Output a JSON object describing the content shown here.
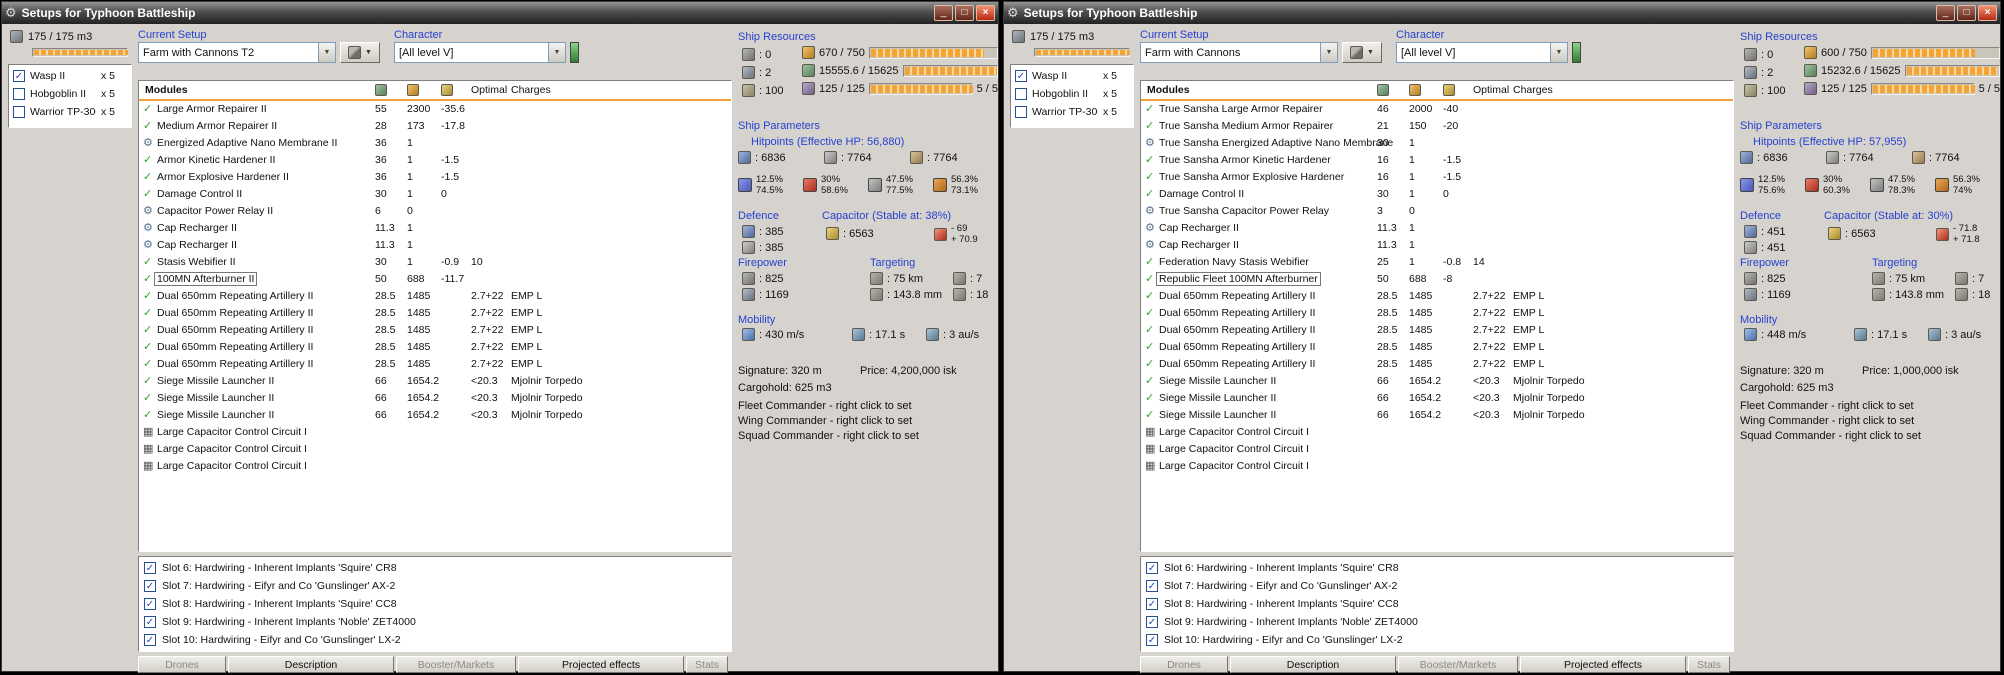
{
  "chrome": {
    "title": "Setups for Typhoon Battleship"
  },
  "labels": {
    "current_setup": "Current Setup",
    "character": "Character",
    "modules": "Modules",
    "optimal": "Optimal",
    "charges": "Charges",
    "ship_resources": "Ship Resources",
    "ship_parameters": "Ship Parameters",
    "defence": "Defence",
    "firepower": "Firepower",
    "targeting": "Targeting",
    "mobility": "Mobility"
  },
  "tabs": [
    {
      "label": "Drones",
      "enabled": false
    },
    {
      "label": "Description",
      "enabled": true
    },
    {
      "label": "Booster/Markets",
      "enabled": false
    },
    {
      "label": "Projected effects",
      "enabled": true
    },
    {
      "label": "Stats",
      "enabled": false
    }
  ],
  "windows": [
    {
      "cargo": {
        "value": "175 / 175 m3",
        "fill": 1
      },
      "drones": [
        {
          "name": "Wasp II",
          "qty": "x 5",
          "checked": true
        },
        {
          "name": "Hobgoblin II",
          "qty": "x 5",
          "checked": false
        },
        {
          "name": "Warrior TP-300",
          "qty": "x 5",
          "checked": false
        }
      ],
      "current_setup": "Farm with Cannons T2",
      "character": "[All level V]",
      "modules": [
        {
          "state": "active",
          "name": "Large Armor Repairer II",
          "cpu": "55",
          "pg": "2300",
          "cap": "-35.6"
        },
        {
          "state": "active",
          "name": "Medium Armor Repairer II",
          "cpu": "28",
          "pg": "173",
          "cap": "-17.8"
        },
        {
          "state": "passive",
          "name": "Energized Adaptive Nano Membrane II",
          "cpu": "36",
          "pg": "1"
        },
        {
          "state": "active",
          "name": "Armor Kinetic Hardener II",
          "cpu": "36",
          "pg": "1",
          "cap": "-1.5"
        },
        {
          "state": "active",
          "name": "Armor Explosive Hardener II",
          "cpu": "36",
          "pg": "1",
          "cap": "-1.5"
        },
        {
          "state": "active",
          "name": "Damage Control II",
          "cpu": "30",
          "pg": "1",
          "cap": "0"
        },
        {
          "state": "passive",
          "name": "Capacitor Power Relay II",
          "cpu": "6",
          "pg": "0"
        },
        {
          "state": "passive",
          "name": "Cap Recharger II",
          "cpu": "11.3",
          "pg": "1"
        },
        {
          "state": "passive",
          "name": "Cap Recharger II",
          "cpu": "11.3",
          "pg": "1"
        },
        {
          "state": "active",
          "name": "Stasis Webifier II",
          "cpu": "30",
          "pg": "1",
          "cap": "-0.9",
          "optimal": "10"
        },
        {
          "state": "active",
          "name": "100MN Afterburner II",
          "cpu": "50",
          "pg": "688",
          "cap": "-11.7",
          "selected": true
        },
        {
          "state": "active",
          "name": "Dual 650mm Repeating Artillery II",
          "cpu": "28.5",
          "pg": "1485",
          "optimal": "2.7+22",
          "charges": "EMP L"
        },
        {
          "state": "active",
          "name": "Dual 650mm Repeating Artillery II",
          "cpu": "28.5",
          "pg": "1485",
          "optimal": "2.7+22",
          "charges": "EMP L"
        },
        {
          "state": "active",
          "name": "Dual 650mm Repeating Artillery II",
          "cpu": "28.5",
          "pg": "1485",
          "optimal": "2.7+22",
          "charges": "EMP L"
        },
        {
          "state": "active",
          "name": "Dual 650mm Repeating Artillery II",
          "cpu": "28.5",
          "pg": "1485",
          "optimal": "2.7+22",
          "charges": "EMP L"
        },
        {
          "state": "active",
          "name": "Dual 650mm Repeating Artillery II",
          "cpu": "28.5",
          "pg": "1485",
          "optimal": "2.7+22",
          "charges": "EMP L"
        },
        {
          "state": "active",
          "name": "Siege Missile Launcher II",
          "cpu": "66",
          "pg": "1654.2",
          "optimal": "<20.3",
          "charges": "Mjolnir Torpedo"
        },
        {
          "state": "active",
          "name": "Siege Missile Launcher II",
          "cpu": "66",
          "pg": "1654.2",
          "optimal": "<20.3",
          "charges": "Mjolnir Torpedo"
        },
        {
          "state": "active",
          "name": "Siege Missile Launcher II",
          "cpu": "66",
          "pg": "1654.2",
          "optimal": "<20.3",
          "charges": "Mjolnir Torpedo"
        },
        {
          "state": "rig",
          "name": "Large Capacitor Control Circuit I"
        },
        {
          "state": "rig",
          "name": "Large Capacitor Control Circuit I"
        },
        {
          "state": "rig",
          "name": "Large Capacitor Control Circuit I"
        }
      ],
      "implants": [
        "Slot 6: Hardwiring - Inherent Implants 'Squire' CR8",
        "Slot 7: Hardwiring - Eifyr and Co 'Gunslinger' AX-2",
        "Slot 8: Hardwiring - Inherent Implants 'Squire' CC8",
        "Slot 9: Hardwiring - Inherent Implants 'Noble' ZET4000",
        "Slot 10: Hardwiring - Eifyr and Co 'Gunslinger' LX-2"
      ],
      "resources": {
        "turrets": ": 0",
        "launchers": ": 2",
        "calibration": ": 100",
        "powergrid": {
          "text": "670 / 750",
          "fill": 0.89
        },
        "cpu": {
          "text": "15555.6 / 15625",
          "fill": 0.99
        },
        "dronebay": {
          "text": "125 / 125",
          "fill": 1
        },
        "drones_count": "5 / 5"
      },
      "parameters": {
        "hitpoints_title": "Hitpoints (Effective HP: 56,880)",
        "shield": ": 6836",
        "armor": ": 7764",
        "hull": ": 7764",
        "resists": [
          {
            "top": "12.5%",
            "bottom": "74.5%"
          },
          {
            "top": "30%",
            "bottom": "58.6%"
          },
          {
            "top": "47.5%",
            "bottom": "77.5%"
          },
          {
            "top": "56.3%",
            "bottom": "73.1%"
          }
        ],
        "defence_shield": ": 385",
        "defence_armor": ": 385",
        "capacitor_title": "Capacitor (Stable at: 38%)",
        "cap_amount": ": 6563",
        "cap_out": "- 69",
        "cap_in": "+ 70.9",
        "firepower_dps": ": 825",
        "firepower_volley": ": 1169",
        "targeting_range": ": 75 km",
        "max_targets": ": 7",
        "scan_resolution": ": 143.8 mm",
        "sensor_strength": ": 18",
        "speed": ": 430 m/s",
        "align_time": ": 17.1 s",
        "warp_speed": ": 3 au/s",
        "signature": "Signature: 320 m",
        "price": "Price: 4,200,000 isk",
        "cargohold": "Cargohold: 625 m3",
        "fleet": "Fleet Commander - right click to set",
        "wing": "Wing Commander - right click to set",
        "squad": "Squad Commander - right click to set"
      }
    },
    {
      "cargo": {
        "value": "175 / 175 m3",
        "fill": 1
      },
      "drones": [
        {
          "name": "Wasp II",
          "qty": "x 5",
          "checked": true
        },
        {
          "name": "Hobgoblin II",
          "qty": "x 5",
          "checked": false
        },
        {
          "name": "Warrior TP-300",
          "qty": "x 5",
          "checked": false
        }
      ],
      "current_setup": "Farm with Cannons",
      "character": "[All level V]",
      "modules": [
        {
          "state": "active",
          "name": "True Sansha Large Armor Repairer",
          "cpu": "46",
          "pg": "2000",
          "cap": "-40"
        },
        {
          "state": "active",
          "name": "True Sansha Medium Armor Repairer",
          "cpu": "21",
          "pg": "150",
          "cap": "-20"
        },
        {
          "state": "passive",
          "name": "True Sansha Energized Adaptive Nano Membrane",
          "cpu": "30",
          "pg": "1"
        },
        {
          "state": "active",
          "name": "True Sansha Armor Kinetic Hardener",
          "cpu": "16",
          "pg": "1",
          "cap": "-1.5"
        },
        {
          "state": "active",
          "name": "True Sansha Armor Explosive Hardener",
          "cpu": "16",
          "pg": "1",
          "cap": "-1.5"
        },
        {
          "state": "active",
          "name": "Damage Control II",
          "cpu": "30",
          "pg": "1",
          "cap": "0"
        },
        {
          "state": "passive",
          "name": "True Sansha Capacitor Power Relay",
          "cpu": "3",
          "pg": "0"
        },
        {
          "state": "passive",
          "name": "Cap Recharger II",
          "cpu": "11.3",
          "pg": "1"
        },
        {
          "state": "passive",
          "name": "Cap Recharger II",
          "cpu": "11.3",
          "pg": "1"
        },
        {
          "state": "active",
          "name": "Federation Navy Stasis Webifier",
          "cpu": "25",
          "pg": "1",
          "cap": "-0.8",
          "optimal": "14"
        },
        {
          "state": "active",
          "name": "Republic Fleet 100MN Afterburner",
          "cpu": "50",
          "pg": "688",
          "cap": "-8",
          "selected": true
        },
        {
          "state": "active",
          "name": "Dual 650mm Repeating Artillery II",
          "cpu": "28.5",
          "pg": "1485",
          "optimal": "2.7+22",
          "charges": "EMP L"
        },
        {
          "state": "active",
          "name": "Dual 650mm Repeating Artillery II",
          "cpu": "28.5",
          "pg": "1485",
          "optimal": "2.7+22",
          "charges": "EMP L"
        },
        {
          "state": "active",
          "name": "Dual 650mm Repeating Artillery II",
          "cpu": "28.5",
          "pg": "1485",
          "optimal": "2.7+22",
          "charges": "EMP L"
        },
        {
          "state": "active",
          "name": "Dual 650mm Repeating Artillery II",
          "cpu": "28.5",
          "pg": "1485",
          "optimal": "2.7+22",
          "charges": "EMP L"
        },
        {
          "state": "active",
          "name": "Dual 650mm Repeating Artillery II",
          "cpu": "28.5",
          "pg": "1485",
          "optimal": "2.7+22",
          "charges": "EMP L"
        },
        {
          "state": "active",
          "name": "Siege Missile Launcher II",
          "cpu": "66",
          "pg": "1654.2",
          "optimal": "<20.3",
          "charges": "Mjolnir Torpedo"
        },
        {
          "state": "active",
          "name": "Siege Missile Launcher II",
          "cpu": "66",
          "pg": "1654.2",
          "optimal": "<20.3",
          "charges": "Mjolnir Torpedo"
        },
        {
          "state": "active",
          "name": "Siege Missile Launcher II",
          "cpu": "66",
          "pg": "1654.2",
          "optimal": "<20.3",
          "charges": "Mjolnir Torpedo"
        },
        {
          "state": "rig",
          "name": "Large Capacitor Control Circuit I"
        },
        {
          "state": "rig",
          "name": "Large Capacitor Control Circuit I"
        },
        {
          "state": "rig",
          "name": "Large Capacitor Control Circuit I"
        }
      ],
      "implants": [
        "Slot 6: Hardwiring - Inherent Implants 'Squire' CR8",
        "Slot 7: Hardwiring - Eifyr and Co 'Gunslinger' AX-2",
        "Slot 8: Hardwiring - Inherent Implants 'Squire' CC8",
        "Slot 9: Hardwiring - Inherent Implants 'Noble' ZET4000",
        "Slot 10: Hardwiring - Eifyr and Co 'Gunslinger' LX-2"
      ],
      "resources": {
        "turrets": ": 0",
        "launchers": ": 2",
        "calibration": ": 100",
        "powergrid": {
          "text": "600 / 750",
          "fill": 0.8
        },
        "cpu": {
          "text": "15232.6 / 15625",
          "fill": 0.97
        },
        "dronebay": {
          "text": "125 / 125",
          "fill": 1
        },
        "drones_count": "5 / 5"
      },
      "parameters": {
        "hitpoints_title": "Hitpoints (Effective HP: 57,955)",
        "shield": ": 6836",
        "armor": ": 7764",
        "hull": ": 7764",
        "resists": [
          {
            "top": "12.5%",
            "bottom": "75.6%"
          },
          {
            "top": "30%",
            "bottom": "60.3%"
          },
          {
            "top": "47.5%",
            "bottom": "78.3%"
          },
          {
            "top": "56.3%",
            "bottom": "74%"
          }
        ],
        "defence_shield": ": 451",
        "defence_armor": ": 451",
        "capacitor_title": "Capacitor (Stable at: 30%)",
        "cap_amount": ": 6563",
        "cap_out": "- 71.8",
        "cap_in": "+ 71.8",
        "firepower_dps": ": 825",
        "firepower_volley": ": 1169",
        "targeting_range": ": 75 km",
        "max_targets": ": 7",
        "scan_resolution": ": 143.8 mm",
        "sensor_strength": ": 18",
        "speed": ": 448 m/s",
        "align_time": ": 17.1 s",
        "warp_speed": ": 3 au/s",
        "signature": "Signature: 320 m",
        "price": "Price: 1,000,000 isk",
        "cargohold": "Cargohold: 625 m3",
        "fleet": "Fleet Commander - right click to set",
        "wing": "Wing Commander - right click to set",
        "squad": "Squad Commander - right click to set"
      }
    }
  ]
}
